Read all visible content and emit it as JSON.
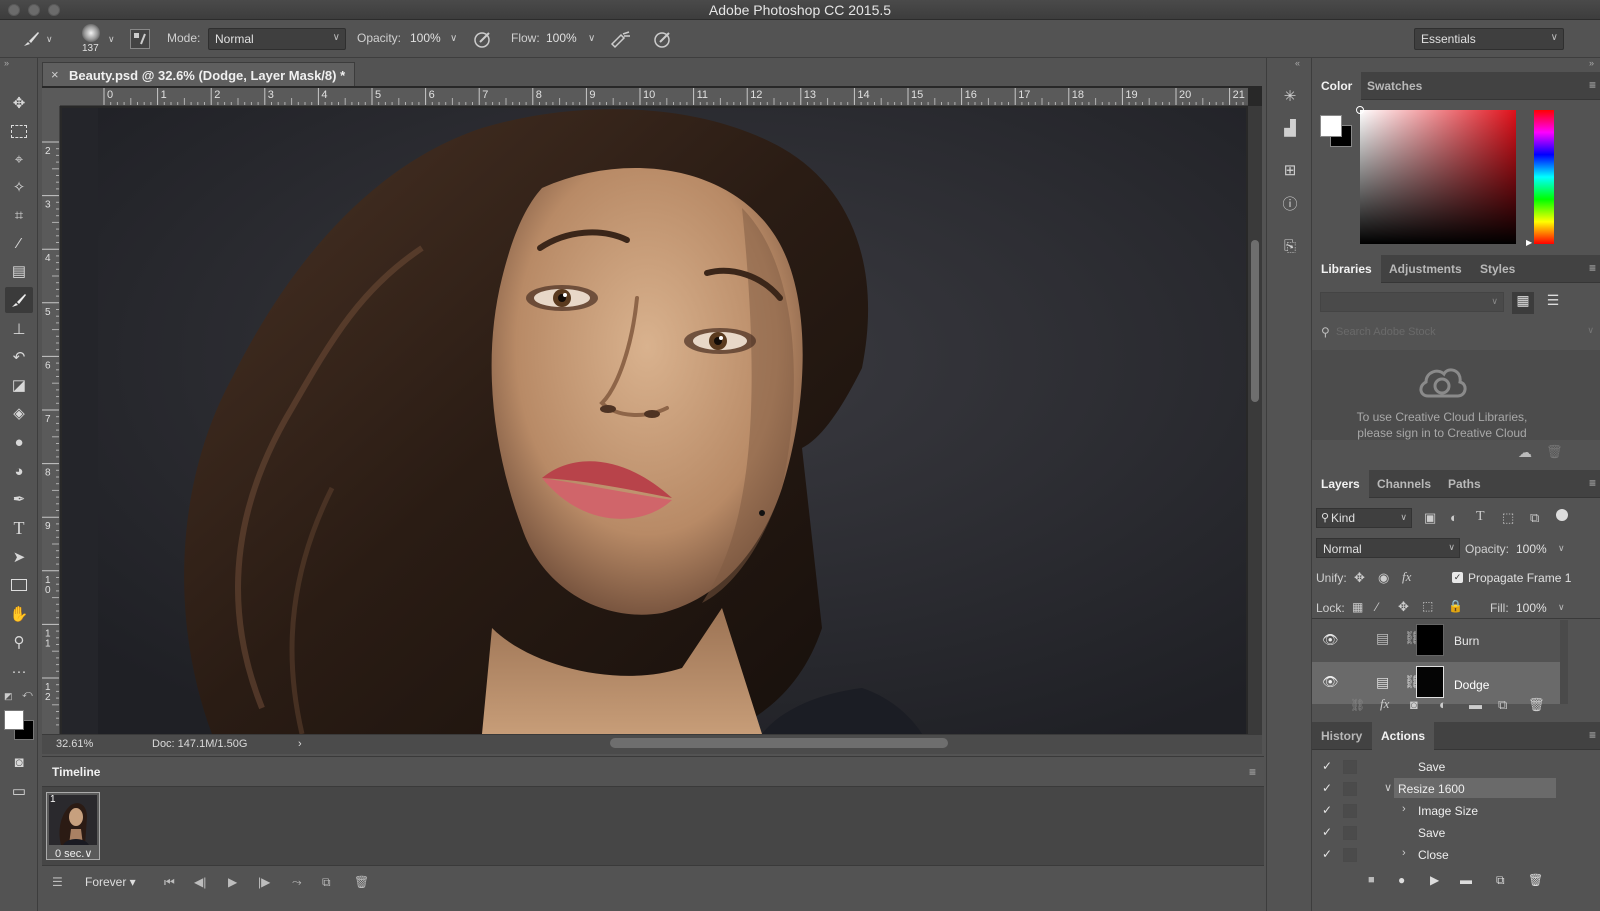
{
  "window": {
    "title": "Adobe Photoshop CC 2015.5"
  },
  "options_bar": {
    "brush_size": "137",
    "mode_label": "Mode:",
    "mode_value": "Normal",
    "opacity_label": "Opacity:",
    "opacity_value": "100%",
    "flow_label": "Flow:",
    "flow_value": "100%",
    "workspace": "Essentials"
  },
  "document": {
    "tab_title": "Beauty.psd @ 32.6% (Dodge, Layer Mask/8) *",
    "zoom": "32.61%",
    "doc_size": "Doc: 147.1M/1.50G",
    "ruler_top": [
      "0",
      "1",
      "2",
      "3",
      "4",
      "5",
      "6",
      "7",
      "8",
      "9",
      "10",
      "11",
      "12",
      "13",
      "14",
      "15",
      "16",
      "17",
      "18",
      "19",
      "20",
      "21"
    ],
    "ruler_left": [
      "2",
      "3",
      "4",
      "5",
      "6",
      "7",
      "8",
      "9",
      "1\n0",
      "1\n1",
      "1\n2"
    ]
  },
  "timeline": {
    "tab": "Timeline",
    "frame_number": "1",
    "frame_duration": "0 sec.",
    "loop": "Forever"
  },
  "color_panel": {
    "tabs": [
      "Color",
      "Swatches"
    ],
    "foreground": "#ffffff",
    "background": "#000000"
  },
  "libraries_panel": {
    "tabs": [
      "Libraries",
      "Adjustments",
      "Styles"
    ],
    "search_placeholder": "Search Adobe Stock",
    "message_line1": "To use Creative Cloud Libraries,",
    "message_line2": "please sign in to Creative Cloud"
  },
  "layers_panel": {
    "tabs": [
      "Layers",
      "Channels",
      "Paths"
    ],
    "filter": "Kind",
    "blend_mode": "Normal",
    "opacity_label": "Opacity:",
    "opacity_value": "100%",
    "unify_label": "Unify:",
    "propagate_label": "Propagate Frame 1",
    "lock_label": "Lock:",
    "fill_label": "Fill:",
    "fill_value": "100%",
    "layers": [
      {
        "name": "Burn",
        "selected": false
      },
      {
        "name": "Dodge",
        "selected": true
      }
    ]
  },
  "actions_panel": {
    "tabs": [
      "History",
      "Actions"
    ],
    "items": [
      {
        "label": "Save",
        "indent": 1,
        "expander": ""
      },
      {
        "label": "Resize 1600",
        "indent": 0,
        "expander": "v",
        "selected": true
      },
      {
        "label": "Image Size",
        "indent": 1,
        "expander": ">"
      },
      {
        "label": "Save",
        "indent": 1,
        "expander": ""
      },
      {
        "label": "Close",
        "indent": 1,
        "expander": ">"
      }
    ]
  }
}
